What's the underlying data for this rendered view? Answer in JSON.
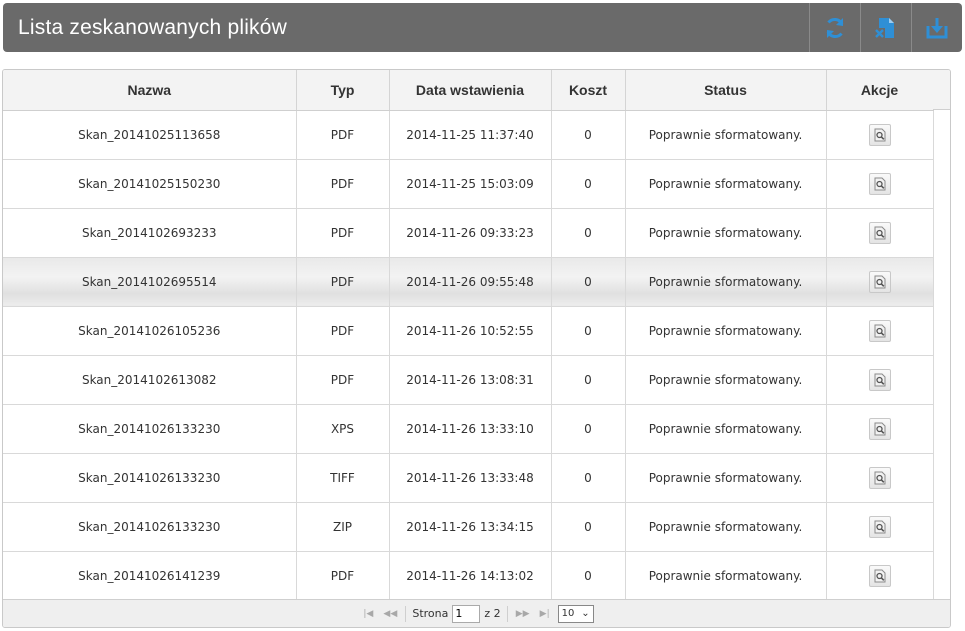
{
  "header": {
    "title": "Lista zeskanowanych plików",
    "buttons": [
      {
        "icon": "refresh-icon"
      },
      {
        "icon": "delete-file-icon"
      },
      {
        "icon": "download-icon"
      }
    ]
  },
  "colors": {
    "accent": "#2f8fd5",
    "header_bg": "#6a6a6a"
  },
  "table": {
    "columns": [
      "Nazwa",
      "Typ",
      "Data wstawienia",
      "Koszt",
      "Status",
      "Akcje"
    ],
    "rows": [
      {
        "name": "Skan_20141025113658",
        "type": "PDF",
        "date": "2014-11-25 11:37:40",
        "cost": "0",
        "status": "Poprawnie sformatowany."
      },
      {
        "name": "Skan_20141025150230",
        "type": "PDF",
        "date": "2014-11-25 15:03:09",
        "cost": "0",
        "status": "Poprawnie sformatowany."
      },
      {
        "name": "Skan_2014102693233",
        "type": "PDF",
        "date": "2014-11-26 09:33:23",
        "cost": "0",
        "status": "Poprawnie sformatowany."
      },
      {
        "name": "Skan_2014102695514",
        "type": "PDF",
        "date": "2014-11-26 09:55:48",
        "cost": "0",
        "status": "Poprawnie sformatowany."
      },
      {
        "name": "Skan_20141026105236",
        "type": "PDF",
        "date": "2014-11-26 10:52:55",
        "cost": "0",
        "status": "Poprawnie sformatowany."
      },
      {
        "name": "Skan_2014102613082",
        "type": "PDF",
        "date": "2014-11-26 13:08:31",
        "cost": "0",
        "status": "Poprawnie sformatowany."
      },
      {
        "name": "Skan_20141026133230",
        "type": "XPS",
        "date": "2014-11-26 13:33:10",
        "cost": "0",
        "status": "Poprawnie sformatowany."
      },
      {
        "name": "Skan_20141026133230",
        "type": "TIFF",
        "date": "2014-11-26 13:33:48",
        "cost": "0",
        "status": "Poprawnie sformatowany."
      },
      {
        "name": "Skan_20141026133230",
        "type": "ZIP",
        "date": "2014-11-26 13:34:15",
        "cost": "0",
        "status": "Poprawnie sformatowany."
      },
      {
        "name": "Skan_20141026141239",
        "type": "PDF",
        "date": "2014-11-26 14:13:02",
        "cost": "0",
        "status": "Poprawnie sformatowany."
      }
    ]
  },
  "pager": {
    "page_label": "Strona",
    "current_page": "1",
    "of_label": "z 2",
    "page_size": "10"
  }
}
